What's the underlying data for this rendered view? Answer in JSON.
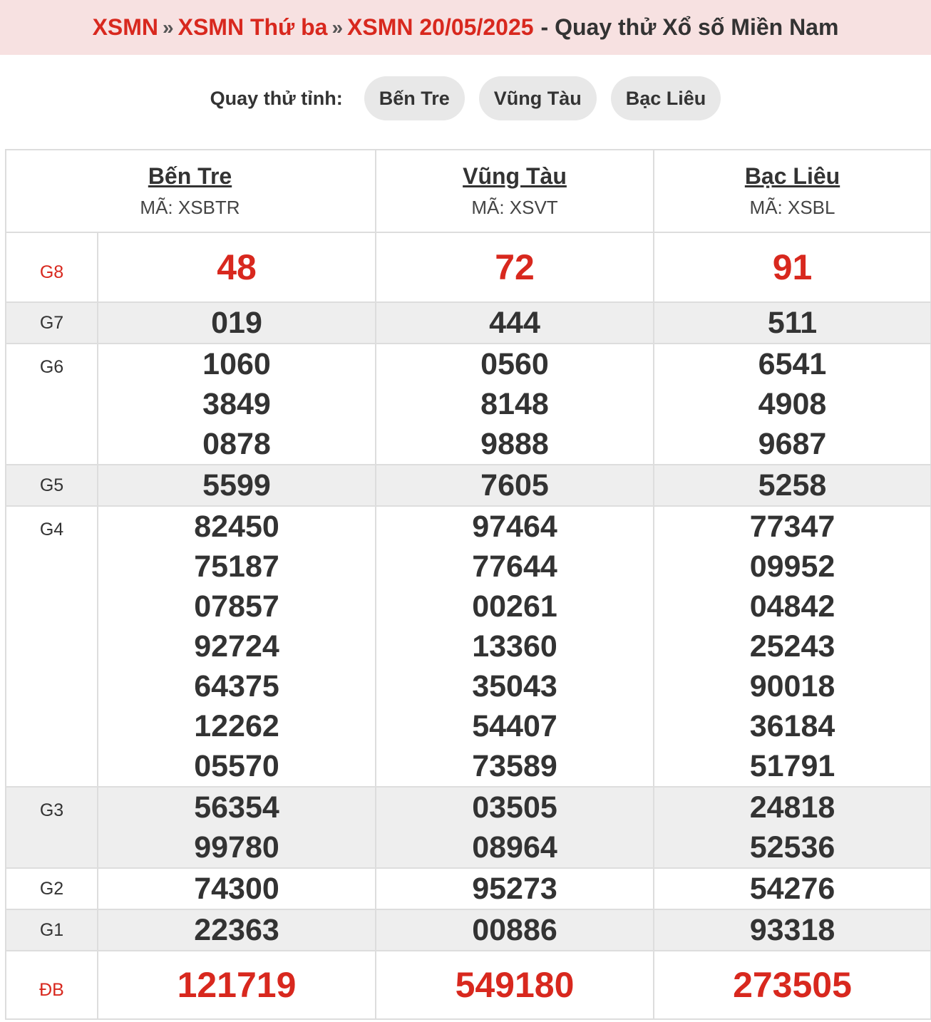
{
  "breadcrumb": {
    "xsmn": "XSMN",
    "weekday": "XSMN Thứ ba",
    "date": "XSMN 20/05/2025",
    "title": "- Quay thử Xổ số Miền Nam"
  },
  "province_bar": {
    "label": "Quay thử tỉnh:",
    "items": [
      "Bến Tre",
      "Vũng Tàu",
      "Bạc Liêu"
    ]
  },
  "provinces": [
    {
      "name": "Bến Tre",
      "code": "MÃ: XSBTR"
    },
    {
      "name": "Vũng Tàu",
      "code": "MÃ: XSVT"
    },
    {
      "name": "Bạc Liêu",
      "code": "MÃ: XSBL"
    }
  ],
  "prizes": [
    {
      "label": "G8",
      "values": [
        [
          "48"
        ],
        [
          "72"
        ],
        [
          "91"
        ]
      ]
    },
    {
      "label": "G7",
      "values": [
        [
          "019"
        ],
        [
          "444"
        ],
        [
          "511"
        ]
      ]
    },
    {
      "label": "G6",
      "values": [
        [
          "1060",
          "3849",
          "0878"
        ],
        [
          "0560",
          "8148",
          "9888"
        ],
        [
          "6541",
          "4908",
          "9687"
        ]
      ]
    },
    {
      "label": "G5",
      "values": [
        [
          "5599"
        ],
        [
          "7605"
        ],
        [
          "5258"
        ]
      ]
    },
    {
      "label": "G4",
      "values": [
        [
          "82450",
          "75187",
          "07857",
          "92724",
          "64375",
          "12262",
          "05570"
        ],
        [
          "97464",
          "77644",
          "00261",
          "13360",
          "35043",
          "54407",
          "73589"
        ],
        [
          "77347",
          "09952",
          "04842",
          "25243",
          "90018",
          "36184",
          "51791"
        ]
      ]
    },
    {
      "label": "G3",
      "values": [
        [
          "56354",
          "99780"
        ],
        [
          "03505",
          "08964"
        ],
        [
          "24818",
          "52536"
        ]
      ]
    },
    {
      "label": "G2",
      "values": [
        [
          "74300"
        ],
        [
          "95273"
        ],
        [
          "54276"
        ]
      ]
    },
    {
      "label": "G1",
      "values": [
        [
          "22363"
        ],
        [
          "00886"
        ],
        [
          "93318"
        ]
      ]
    },
    {
      "label": "ĐB",
      "values": [
        [
          "121719"
        ],
        [
          "549180"
        ],
        [
          "273505"
        ]
      ]
    }
  ],
  "colors": {
    "accent_red": "#d8281e",
    "header_bg": "#f7e1e1",
    "stripe_bg": "#eeeeee",
    "pill_bg": "#e8e8e8"
  }
}
